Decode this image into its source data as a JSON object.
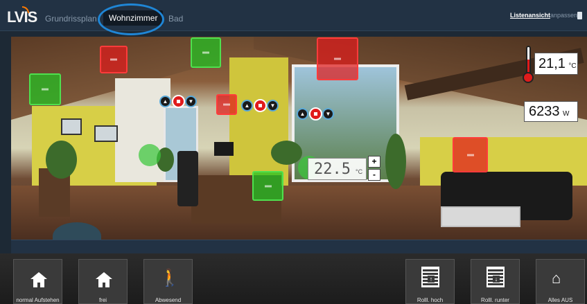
{
  "header": {
    "logo": "LVIS",
    "tabs": [
      {
        "label": "Grundrissplan",
        "active": false
      },
      {
        "label": "Wohnzimmer",
        "active": true
      },
      {
        "label": "Bad",
        "active": false
      }
    ],
    "list_view_label": "Listenansicht",
    "customize_label": "anpassen"
  },
  "room": {
    "temperature": {
      "value": "21,1",
      "unit": "°C"
    },
    "power": {
      "value": "6233",
      "unit": "W"
    },
    "setpoint": {
      "value": "22.5",
      "unit": "°C",
      "plus": "+",
      "minus": "-"
    }
  },
  "scenes": [
    {
      "label": "normal Aufstehen",
      "icon": "home-icon"
    },
    {
      "label": "frei",
      "icon": "home-icon"
    },
    {
      "label": "Abwesend",
      "icon": "walking-person-icon"
    },
    {
      "label": "Rolll. hoch",
      "icon": "blind-up-icon"
    },
    {
      "label": "Rolll. runter",
      "icon": "blind-down-icon"
    },
    {
      "label": "Alles AUS",
      "icon": "house-exit-icon"
    }
  ],
  "colors": {
    "accent": "#1f86d6",
    "on": "#23c323",
    "off": "#e11c1c",
    "bar": "#223244"
  }
}
